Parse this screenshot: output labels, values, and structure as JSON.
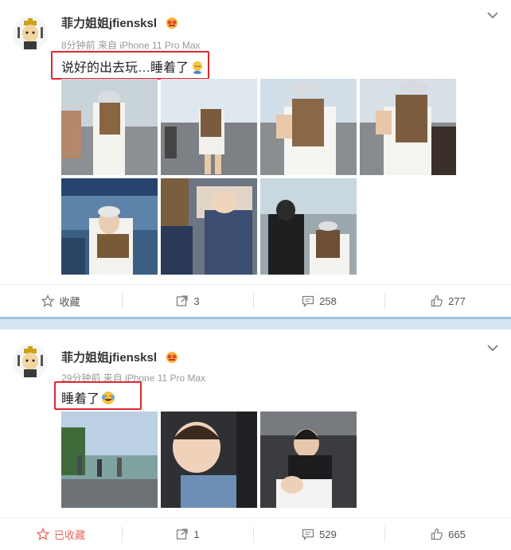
{
  "posts": [
    {
      "username": "菲力姐姐jfiensksl",
      "meta": "8分钟前 来自 iPhone 11 Pro Max",
      "text": "说好的出去玩…睡着了",
      "emoji": "sleeping-emoji",
      "actions": {
        "favorite": "收藏",
        "repost": "3",
        "comment": "258",
        "like": "277"
      },
      "favorite_color": "#808080"
    },
    {
      "username": "菲力姐姐jfiensksl",
      "meta": "29分钟前 来自 iPhone 11 Pro Max",
      "text": "睡着了",
      "emoji": "laughing-tears-emoji",
      "actions": {
        "favorite": "已收藏",
        "repost": "1",
        "comment": "529",
        "like": "665"
      },
      "favorite_color": "#e8685d"
    }
  ],
  "colors": {
    "highlight_box": "#e0262f",
    "divider": "#d6e5ef",
    "divider_border": "#9bc3dd"
  },
  "icons": [
    "chevron-down-icon",
    "star-icon",
    "repost-icon",
    "comment-icon",
    "like-icon",
    "vip-badge-icon"
  ]
}
